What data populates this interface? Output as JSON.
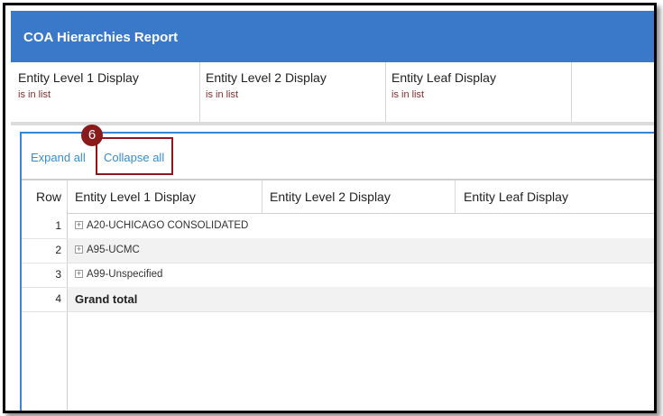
{
  "header": {
    "title": "COA Hierarchies Report"
  },
  "filters": [
    {
      "label": "Entity Level 1 Display",
      "condition": "is in list"
    },
    {
      "label": "Entity Level 2 Display",
      "condition": "is in list"
    },
    {
      "label": "Entity Leaf Display",
      "condition": "is in list"
    }
  ],
  "toolbar": {
    "expand_label": "Expand all",
    "collapse_label": "Collapse all"
  },
  "annotation": {
    "step": "6"
  },
  "table": {
    "columns": [
      "Row",
      "Entity Level 1 Display",
      "Entity Level 2 Display",
      "Entity Leaf Display"
    ],
    "rows": [
      {
        "num": "1",
        "value": "A20-UCHICAGO CONSOLIDATED",
        "expandable": true
      },
      {
        "num": "2",
        "value": "A95-UCMC",
        "expandable": true
      },
      {
        "num": "3",
        "value": "A99-Unspecified",
        "expandable": true
      },
      {
        "num": "4",
        "value": "Grand total",
        "expandable": false
      }
    ]
  },
  "colors": {
    "header": "#3a78c9",
    "link": "#3a8dcc",
    "annotation": "#8b1a1a"
  }
}
